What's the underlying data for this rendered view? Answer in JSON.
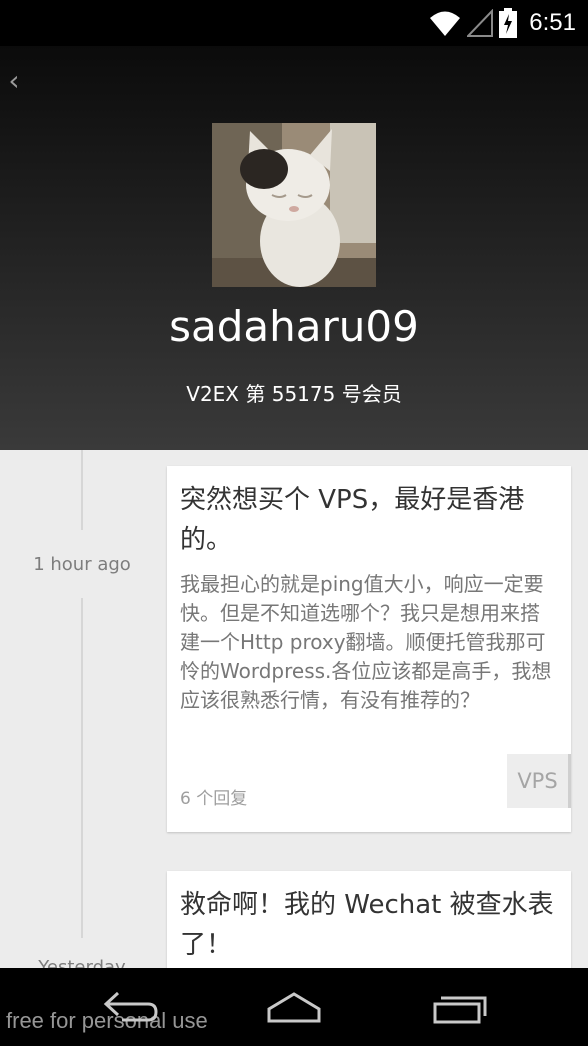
{
  "status_bar": {
    "time": "6:51",
    "icons": [
      "wifi-icon",
      "signal-icon",
      "battery-charging-icon"
    ]
  },
  "header": {
    "back_icon": "back-chevron-icon",
    "username": "sadaharu09",
    "member_line": "V2EX 第 55175 号会员"
  },
  "timeline": {
    "items": [
      {
        "time": "1 hour ago",
        "title": "突然想买个 VPS，最好是香港的。",
        "body": "我最担心的就是ping值大小，响应一定要快。但是不知道选哪个？我只是想用来搭建一个Http proxy翻墙。顺便托管我那可怜的Wordpress.各位应该都是高手，我想应该很熟悉行情，有没有推荐的？",
        "replies": "6 个回复",
        "node": "VPS"
      },
      {
        "time": "Yesterday",
        "title": "救命啊！我的 Wechat 被查水表了！"
      }
    ]
  },
  "nav_bar": {
    "icons": [
      "back-nav-icon",
      "home-nav-icon",
      "recents-nav-icon"
    ]
  },
  "watermark": "free for personal use",
  "colors": {
    "header_top": "#0b0b0b",
    "header_bottom": "#3a3a3a",
    "timeline_bg": "#ececec",
    "card_bg": "#ffffff"
  }
}
